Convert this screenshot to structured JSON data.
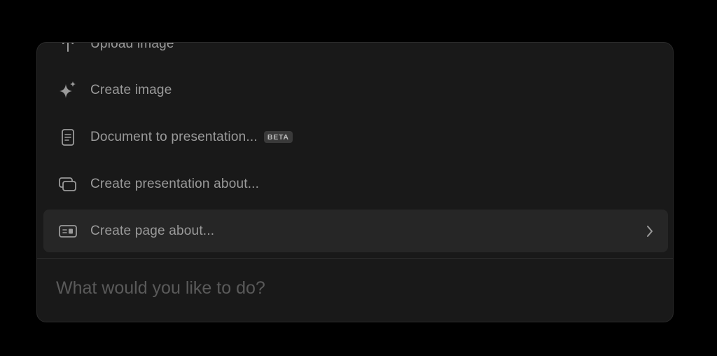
{
  "menu": {
    "items": [
      {
        "label": "Upload image",
        "icon": "arrow-up-icon"
      },
      {
        "label": "Create image",
        "icon": "sparkles-icon"
      },
      {
        "label": "Document to presentation...",
        "icon": "document-icon",
        "badge": "BETA"
      },
      {
        "label": "Create presentation about...",
        "icon": "slides-icon"
      },
      {
        "label": "Create page about...",
        "icon": "page-card-icon",
        "active": true
      }
    ]
  },
  "prompt": {
    "value": "",
    "placeholder": "What would you like to do?"
  },
  "colors": {
    "background": "#000000",
    "panel": "#191919",
    "active_item": "#262626",
    "text": "#9a9a9a",
    "badge_bg": "#3a3a3a"
  }
}
